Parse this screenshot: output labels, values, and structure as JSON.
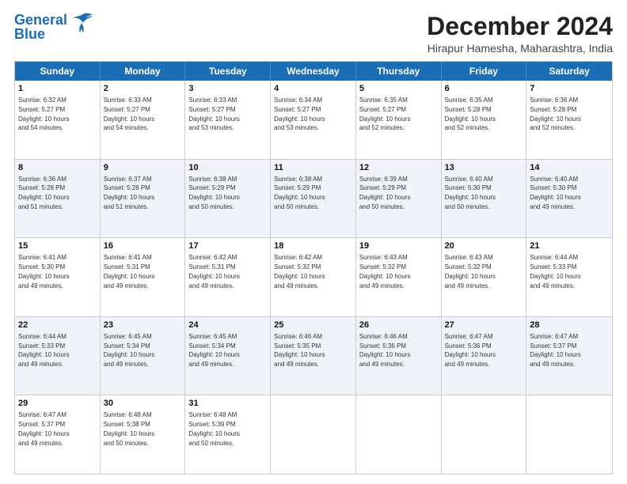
{
  "logo": {
    "line1": "General",
    "line2": "Blue"
  },
  "title": "December 2024",
  "location": "Hirapur Hamesha, Maharashtra, India",
  "header_days": [
    "Sunday",
    "Monday",
    "Tuesday",
    "Wednesday",
    "Thursday",
    "Friday",
    "Saturday"
  ],
  "weeks": [
    [
      {
        "day": "1",
        "sunrise": "Sunrise: 6:32 AM",
        "sunset": "Sunset: 5:27 PM",
        "daylight": "Daylight: 10 hours and 54 minutes."
      },
      {
        "day": "2",
        "sunrise": "Sunrise: 6:33 AM",
        "sunset": "Sunset: 5:27 PM",
        "daylight": "Daylight: 10 hours and 54 minutes."
      },
      {
        "day": "3",
        "sunrise": "Sunrise: 6:33 AM",
        "sunset": "Sunset: 5:27 PM",
        "daylight": "Daylight: 10 hours and 53 minutes."
      },
      {
        "day": "4",
        "sunrise": "Sunrise: 6:34 AM",
        "sunset": "Sunset: 5:27 PM",
        "daylight": "Daylight: 10 hours and 53 minutes."
      },
      {
        "day": "5",
        "sunrise": "Sunrise: 6:35 AM",
        "sunset": "Sunset: 5:27 PM",
        "daylight": "Daylight: 10 hours and 52 minutes."
      },
      {
        "day": "6",
        "sunrise": "Sunrise: 6:35 AM",
        "sunset": "Sunset: 5:28 PM",
        "daylight": "Daylight: 10 hours and 52 minutes."
      },
      {
        "day": "7",
        "sunrise": "Sunrise: 6:36 AM",
        "sunset": "Sunset: 5:28 PM",
        "daylight": "Daylight: 10 hours and 52 minutes."
      }
    ],
    [
      {
        "day": "8",
        "sunrise": "Sunrise: 6:36 AM",
        "sunset": "Sunset: 5:28 PM",
        "daylight": "Daylight: 10 hours and 51 minutes."
      },
      {
        "day": "9",
        "sunrise": "Sunrise: 6:37 AM",
        "sunset": "Sunset: 5:28 PM",
        "daylight": "Daylight: 10 hours and 51 minutes."
      },
      {
        "day": "10",
        "sunrise": "Sunrise: 6:38 AM",
        "sunset": "Sunset: 5:29 PM",
        "daylight": "Daylight: 10 hours and 50 minutes."
      },
      {
        "day": "11",
        "sunrise": "Sunrise: 6:38 AM",
        "sunset": "Sunset: 5:29 PM",
        "daylight": "Daylight: 10 hours and 50 minutes."
      },
      {
        "day": "12",
        "sunrise": "Sunrise: 6:39 AM",
        "sunset": "Sunset: 5:29 PM",
        "daylight": "Daylight: 10 hours and 50 minutes."
      },
      {
        "day": "13",
        "sunrise": "Sunrise: 6:40 AM",
        "sunset": "Sunset: 5:30 PM",
        "daylight": "Daylight: 10 hours and 50 minutes."
      },
      {
        "day": "14",
        "sunrise": "Sunrise: 6:40 AM",
        "sunset": "Sunset: 5:30 PM",
        "daylight": "Daylight: 10 hours and 49 minutes."
      }
    ],
    [
      {
        "day": "15",
        "sunrise": "Sunrise: 6:41 AM",
        "sunset": "Sunset: 5:30 PM",
        "daylight": "Daylight: 10 hours and 49 minutes."
      },
      {
        "day": "16",
        "sunrise": "Sunrise: 6:41 AM",
        "sunset": "Sunset: 5:31 PM",
        "daylight": "Daylight: 10 hours and 49 minutes."
      },
      {
        "day": "17",
        "sunrise": "Sunrise: 6:42 AM",
        "sunset": "Sunset: 5:31 PM",
        "daylight": "Daylight: 10 hours and 49 minutes."
      },
      {
        "day": "18",
        "sunrise": "Sunrise: 6:42 AM",
        "sunset": "Sunset: 5:32 PM",
        "daylight": "Daylight: 10 hours and 49 minutes."
      },
      {
        "day": "19",
        "sunrise": "Sunrise: 6:43 AM",
        "sunset": "Sunset: 5:32 PM",
        "daylight": "Daylight: 10 hours and 49 minutes."
      },
      {
        "day": "20",
        "sunrise": "Sunrise: 6:43 AM",
        "sunset": "Sunset: 5:32 PM",
        "daylight": "Daylight: 10 hours and 49 minutes."
      },
      {
        "day": "21",
        "sunrise": "Sunrise: 6:44 AM",
        "sunset": "Sunset: 5:33 PM",
        "daylight": "Daylight: 10 hours and 49 minutes."
      }
    ],
    [
      {
        "day": "22",
        "sunrise": "Sunrise: 6:44 AM",
        "sunset": "Sunset: 5:33 PM",
        "daylight": "Daylight: 10 hours and 49 minutes."
      },
      {
        "day": "23",
        "sunrise": "Sunrise: 6:45 AM",
        "sunset": "Sunset: 5:34 PM",
        "daylight": "Daylight: 10 hours and 49 minutes."
      },
      {
        "day": "24",
        "sunrise": "Sunrise: 6:45 AM",
        "sunset": "Sunset: 5:34 PM",
        "daylight": "Daylight: 10 hours and 49 minutes."
      },
      {
        "day": "25",
        "sunrise": "Sunrise: 6:46 AM",
        "sunset": "Sunset: 5:35 PM",
        "daylight": "Daylight: 10 hours and 49 minutes."
      },
      {
        "day": "26",
        "sunrise": "Sunrise: 6:46 AM",
        "sunset": "Sunset: 5:36 PM",
        "daylight": "Daylight: 10 hours and 49 minutes."
      },
      {
        "day": "27",
        "sunrise": "Sunrise: 6:47 AM",
        "sunset": "Sunset: 5:36 PM",
        "daylight": "Daylight: 10 hours and 49 minutes."
      },
      {
        "day": "28",
        "sunrise": "Sunrise: 6:47 AM",
        "sunset": "Sunset: 5:37 PM",
        "daylight": "Daylight: 10 hours and 49 minutes."
      }
    ],
    [
      {
        "day": "29",
        "sunrise": "Sunrise: 6:47 AM",
        "sunset": "Sunset: 5:37 PM",
        "daylight": "Daylight: 10 hours and 49 minutes."
      },
      {
        "day": "30",
        "sunrise": "Sunrise: 6:48 AM",
        "sunset": "Sunset: 5:38 PM",
        "daylight": "Daylight: 10 hours and 50 minutes."
      },
      {
        "day": "31",
        "sunrise": "Sunrise: 6:48 AM",
        "sunset": "Sunset: 5:39 PM",
        "daylight": "Daylight: 10 hours and 50 minutes."
      },
      null,
      null,
      null,
      null
    ]
  ]
}
